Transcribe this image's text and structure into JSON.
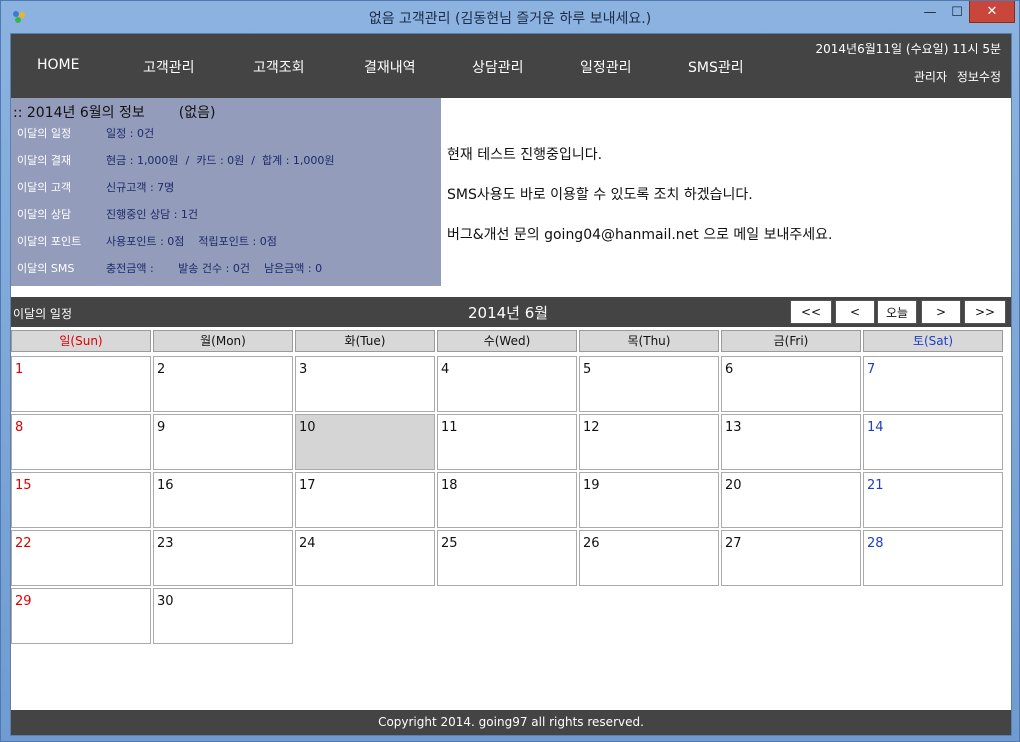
{
  "window": {
    "title": "없음 고객관리  (김동현님 즐거운 하루 보내세요.)",
    "min": "—",
    "max": "☐",
    "close": "✕"
  },
  "nav": {
    "items": [
      "HOME",
      "고객관리",
      "고객조회",
      "결재내역",
      "상담관리",
      "일정관리",
      "SMS관리"
    ],
    "active_index": 1,
    "date": "2014년6월11일 (수요일) 11시 5분",
    "links": [
      "관리자",
      "정보수정"
    ],
    "active_color": "#f0a030"
  },
  "info": {
    "title": ":: 2014년 6월의 정보",
    "status": "(없음)",
    "rows": [
      {
        "label": "이달의 일정",
        "value": "일정 : 0건"
      },
      {
        "label": "이달의 결재",
        "value": "현금 : 1,000원  /  카드 : 0원  /  합계 : 1,000원"
      },
      {
        "label": "이달의 고객",
        "value": "신규고객 : 7명"
      },
      {
        "label": "이달의 상담",
        "value": "진행중인 상담 : 1건"
      },
      {
        "label": "이달의 포인트",
        "value": "사용포인트 : 0점    적립포인트 : 0점"
      },
      {
        "label": "이달의 SMS",
        "value": "충전금액 :       발송 건수 : 0건    남은금액 : 0"
      }
    ]
  },
  "notice": [
    "현재 테스트 진행중입니다.",
    "SMS사용도 바로 이용할 수 있도록 조치 하겠습니다.",
    "버그&개선 문의 going04@hanmail.net 으로 메일 보내주세요."
  ],
  "calendar": {
    "section_label": "이달의 일정",
    "month_label": "2014년 6월",
    "buttons": [
      "<<",
      "<",
      "오늘",
      ">",
      ">>"
    ],
    "weekdays": [
      "일(Sun)",
      "월(Mon)",
      "화(Tue)",
      "수(Wed)",
      "목(Thu)",
      "금(Fri)",
      "토(Sat)"
    ],
    "days": [
      "1",
      "2",
      "3",
      "4",
      "5",
      "6",
      "7",
      "8",
      "9",
      "10",
      "11",
      "12",
      "13",
      "14",
      "15",
      "16",
      "17",
      "18",
      "19",
      "20",
      "21",
      "22",
      "23",
      "24",
      "25",
      "26",
      "27",
      "28",
      "29",
      "30"
    ],
    "first_weekday": 0,
    "today": "10",
    "sun_color": "#dd0000",
    "sat_color": "#1e3ec8"
  },
  "footer": "Copyright 2014. going97 all rights reserved."
}
